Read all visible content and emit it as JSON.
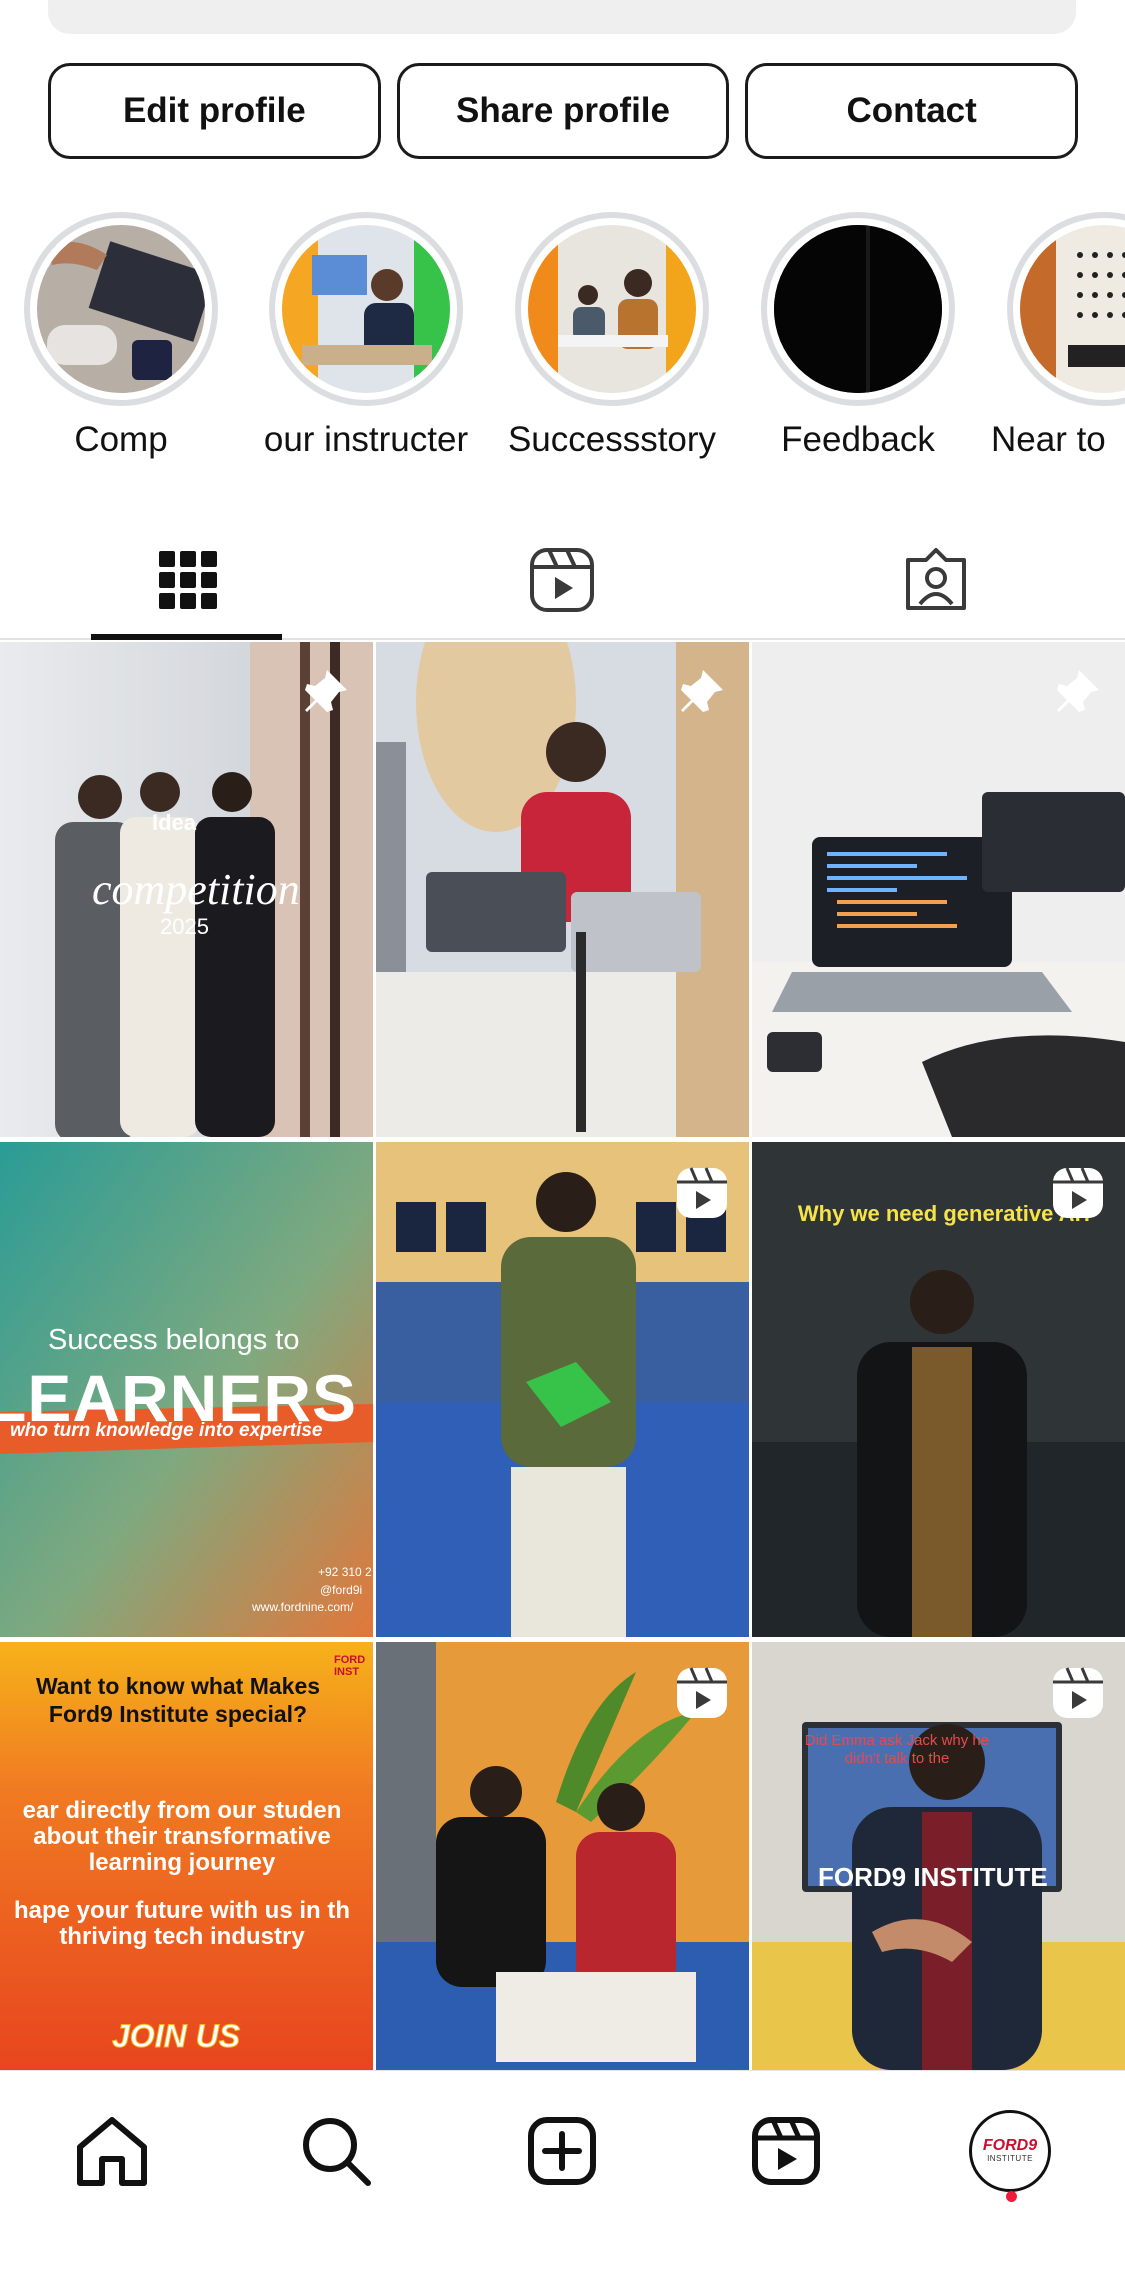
{
  "profile_actions": {
    "edit": "Edit profile",
    "share": "Share profile",
    "contact": "Contact"
  },
  "highlights": [
    {
      "label": "Comp"
    },
    {
      "label": "our instructer"
    },
    {
      "label": "Successstory"
    },
    {
      "label": "Feedback"
    },
    {
      "label": "Near to"
    }
  ],
  "tabs": [
    {
      "icon": "grid-icon",
      "active": true
    },
    {
      "icon": "reels-icon",
      "active": false
    },
    {
      "icon": "tagged-icon",
      "active": false
    }
  ],
  "posts": [
    {
      "badge": "pin-icon",
      "text_a": "Idea",
      "text_b": "competition",
      "text_c": "2025"
    },
    {
      "badge": "pin-icon"
    },
    {
      "badge": "pin-icon"
    },
    {
      "badge": "",
      "text_a": "Success belongs to",
      "text_b": "LEARNERS",
      "text_c": "who turn knowledge into expertise",
      "text_d": "+92 310 2",
      "text_e": "@ford9i",
      "text_f": "www.fordnine.com/"
    },
    {
      "badge": "reel-icon"
    },
    {
      "badge": "reel-icon",
      "text_a": "Why we need generative AI?"
    },
    {
      "badge": "",
      "text_a": "Want to know what Makes Ford9 Institute special?",
      "text_b": "ear directly from our studen about their transformative learning journey",
      "text_c": "hape your future with us in th thriving tech industry",
      "text_d": "JOIN US",
      "text_e": "FORD INST"
    },
    {
      "badge": "reel-icon"
    },
    {
      "badge": "reel-icon",
      "text_a": "FORD9 INSTITUTE",
      "text_b": "Did Emma ask Jack why he didn't talk to the"
    }
  ],
  "nav": {
    "items": [
      "home-icon",
      "search-icon",
      "create-icon",
      "reels-icon",
      "profile-avatar"
    ],
    "avatar_text": "FORD9",
    "avatar_sub": "INSTITUTE"
  },
  "colors": {
    "accent_red": "#ed1c3c",
    "ring": "#dcdde0"
  }
}
